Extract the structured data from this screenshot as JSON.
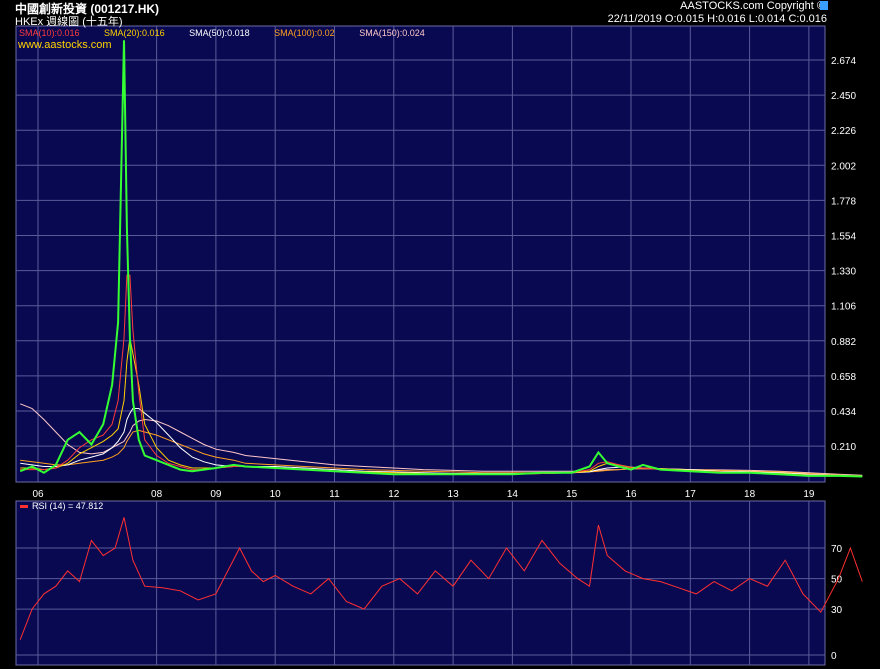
{
  "header": {
    "title": "中國創新投資 (001217.HK)",
    "subtitle": "HKEx 週線圖 (十五年)",
    "website": "www.aastocks.com",
    "copyright": "AASTOCKS.com Copyright ©",
    "quote": "22/11/2019  O:0.015  H:0.016  L:0.014  C:0.016"
  },
  "sma_legend": [
    {
      "label": "SMA(10):0.016",
      "color": "#ff3b3b"
    },
    {
      "label": "SMA(20):0.016",
      "color": "#ffd000"
    },
    {
      "label": "SMA(50):0.018",
      "color": "#ffffff"
    },
    {
      "label": "SMA(100):0.02",
      "color": "#ffa020"
    },
    {
      "label": "SMA(150):0.024",
      "color": "#ffc8c8"
    }
  ],
  "rsi_label": "RSI (14)  = 47.812",
  "colors": {
    "panel_bg": "#090952",
    "grid": "#5a5a9a",
    "price_up": "#33ff33",
    "price_alt": "#29b6ff",
    "rsi": "#ff3030"
  },
  "chart_data": [
    {
      "type": "line",
      "title": "中國創新投資 (001217.HK)",
      "x_ticks": [
        "06",
        "08",
        "09",
        "10",
        "11",
        "12",
        "13",
        "14",
        "15",
        "16",
        "17",
        "18",
        "19"
      ],
      "y_ticks": [
        0.21,
        0.434,
        0.658,
        0.882,
        1.106,
        1.33,
        1.554,
        1.778,
        2.002,
        2.226,
        2.45,
        2.674
      ],
      "ylim": [
        0.0,
        2.85
      ],
      "grid": true,
      "x": [
        2005.7,
        2005.9,
        2006.1,
        2006.3,
        2006.5,
        2006.7,
        2006.9,
        2007.1,
        2007.25,
        2007.35,
        2007.45,
        2007.5,
        2007.55,
        2007.6,
        2007.7,
        2007.8,
        2008.0,
        2008.2,
        2008.4,
        2008.6,
        2008.8,
        2009.0,
        2009.3,
        2009.5,
        2010.0,
        2010.5,
        2011.0,
        2011.5,
        2012.0,
        2012.5,
        2013.0,
        2013.5,
        2014.0,
        2014.5,
        2015.0,
        2015.3,
        2015.45,
        2015.6,
        2015.8,
        2016.0,
        2016.2,
        2016.5,
        2017.0,
        2017.5,
        2018.0,
        2018.5,
        2019.0,
        2019.5,
        2019.9
      ],
      "series": [
        {
          "name": "close",
          "color": "#33ff33",
          "values": [
            0.05,
            0.08,
            0.04,
            0.09,
            0.25,
            0.3,
            0.22,
            0.35,
            0.6,
            1.0,
            2.8,
            1.6,
            0.9,
            0.5,
            0.25,
            0.15,
            0.12,
            0.09,
            0.06,
            0.05,
            0.06,
            0.07,
            0.09,
            0.08,
            0.07,
            0.06,
            0.05,
            0.04,
            0.03,
            0.03,
            0.03,
            0.03,
            0.03,
            0.04,
            0.04,
            0.08,
            0.17,
            0.1,
            0.08,
            0.06,
            0.09,
            0.06,
            0.05,
            0.04,
            0.04,
            0.03,
            0.02,
            0.02,
            0.016
          ]
        },
        {
          "name": "SMA(10)",
          "color": "#ff3b3b",
          "values": [
            0.06,
            0.06,
            0.06,
            0.07,
            0.12,
            0.2,
            0.25,
            0.28,
            0.35,
            0.5,
            0.9,
            1.3,
            1.3,
            0.95,
            0.55,
            0.25,
            0.15,
            0.1,
            0.08,
            0.06,
            0.06,
            0.07,
            0.08,
            0.08,
            0.07,
            0.06,
            0.05,
            0.04,
            0.035,
            0.03,
            0.03,
            0.03,
            0.03,
            0.035,
            0.04,
            0.06,
            0.1,
            0.11,
            0.09,
            0.07,
            0.07,
            0.06,
            0.05,
            0.045,
            0.04,
            0.03,
            0.025,
            0.02,
            0.016
          ]
        },
        {
          "name": "SMA(20)",
          "color": "#ffd000",
          "values": [
            0.07,
            0.07,
            0.06,
            0.07,
            0.1,
            0.16,
            0.2,
            0.24,
            0.28,
            0.32,
            0.5,
            0.75,
            0.9,
            0.8,
            0.6,
            0.35,
            0.2,
            0.12,
            0.09,
            0.07,
            0.07,
            0.07,
            0.08,
            0.08,
            0.07,
            0.06,
            0.05,
            0.045,
            0.04,
            0.035,
            0.03,
            0.03,
            0.03,
            0.035,
            0.04,
            0.05,
            0.08,
            0.1,
            0.09,
            0.075,
            0.07,
            0.065,
            0.055,
            0.045,
            0.04,
            0.035,
            0.025,
            0.02,
            0.016
          ]
        },
        {
          "name": "SMA(50)",
          "color": "#ffffff",
          "values": [
            0.1,
            0.09,
            0.08,
            0.08,
            0.09,
            0.12,
            0.14,
            0.16,
            0.2,
            0.24,
            0.3,
            0.38,
            0.42,
            0.45,
            0.45,
            0.42,
            0.36,
            0.28,
            0.2,
            0.14,
            0.11,
            0.09,
            0.08,
            0.08,
            0.08,
            0.07,
            0.06,
            0.05,
            0.045,
            0.04,
            0.035,
            0.035,
            0.035,
            0.035,
            0.04,
            0.045,
            0.06,
            0.07,
            0.075,
            0.075,
            0.07,
            0.065,
            0.06,
            0.05,
            0.045,
            0.04,
            0.03,
            0.022,
            0.018
          ]
        },
        {
          "name": "SMA(100)",
          "color": "#ffa020",
          "values": [
            0.12,
            0.11,
            0.1,
            0.09,
            0.09,
            0.1,
            0.11,
            0.12,
            0.14,
            0.16,
            0.2,
            0.24,
            0.27,
            0.3,
            0.31,
            0.3,
            0.28,
            0.25,
            0.22,
            0.19,
            0.16,
            0.14,
            0.12,
            0.1,
            0.09,
            0.08,
            0.07,
            0.06,
            0.055,
            0.05,
            0.045,
            0.04,
            0.04,
            0.04,
            0.04,
            0.045,
            0.05,
            0.055,
            0.06,
            0.065,
            0.065,
            0.065,
            0.06,
            0.055,
            0.05,
            0.045,
            0.035,
            0.025,
            0.02
          ]
        },
        {
          "name": "SMA(150)",
          "color": "#ffc8c8",
          "values": [
            0.48,
            0.45,
            0.38,
            0.3,
            0.22,
            0.17,
            0.16,
            0.17,
            0.2,
            0.22,
            0.24,
            0.27,
            0.3,
            0.34,
            0.37,
            0.38,
            0.37,
            0.34,
            0.3,
            0.26,
            0.22,
            0.19,
            0.17,
            0.15,
            0.13,
            0.11,
            0.09,
            0.08,
            0.07,
            0.06,
            0.055,
            0.05,
            0.05,
            0.05,
            0.05,
            0.05,
            0.055,
            0.06,
            0.06,
            0.065,
            0.065,
            0.065,
            0.06,
            0.058,
            0.055,
            0.05,
            0.04,
            0.03,
            0.024
          ]
        }
      ]
    },
    {
      "type": "line",
      "title": "RSI (14)",
      "y_ticks": [
        0,
        30,
        50,
        70
      ],
      "ylim": [
        0,
        100
      ],
      "grid": true,
      "x": [
        2005.7,
        2005.9,
        2006.1,
        2006.3,
        2006.5,
        2006.7,
        2006.9,
        2007.1,
        2007.3,
        2007.45,
        2007.6,
        2007.8,
        2008.1,
        2008.4,
        2008.7,
        2009.0,
        2009.2,
        2009.4,
        2009.6,
        2009.8,
        2010.0,
        2010.3,
        2010.6,
        2010.9,
        2011.2,
        2011.5,
        2011.8,
        2012.1,
        2012.4,
        2012.7,
        2013.0,
        2013.3,
        2013.6,
        2013.9,
        2014.2,
        2014.5,
        2014.8,
        2015.1,
        2015.3,
        2015.45,
        2015.6,
        2015.9,
        2016.2,
        2016.5,
        2016.8,
        2017.1,
        2017.4,
        2017.7,
        2018.0,
        2018.3,
        2018.6,
        2018.9,
        2019.2,
        2019.5,
        2019.7,
        2019.9
      ],
      "series": [
        {
          "name": "RSI (14)",
          "color": "#ff3030",
          "values": [
            10,
            30,
            40,
            45,
            55,
            48,
            75,
            65,
            70,
            90,
            62,
            45,
            44,
            42,
            36,
            40,
            55,
            70,
            55,
            48,
            52,
            45,
            40,
            50,
            35,
            30,
            45,
            50,
            40,
            55,
            45,
            62,
            50,
            70,
            55,
            75,
            60,
            50,
            45,
            85,
            65,
            55,
            50,
            48,
            44,
            40,
            48,
            42,
            50,
            45,
            62,
            40,
            28,
            50,
            70,
            48
          ]
        }
      ]
    }
  ]
}
